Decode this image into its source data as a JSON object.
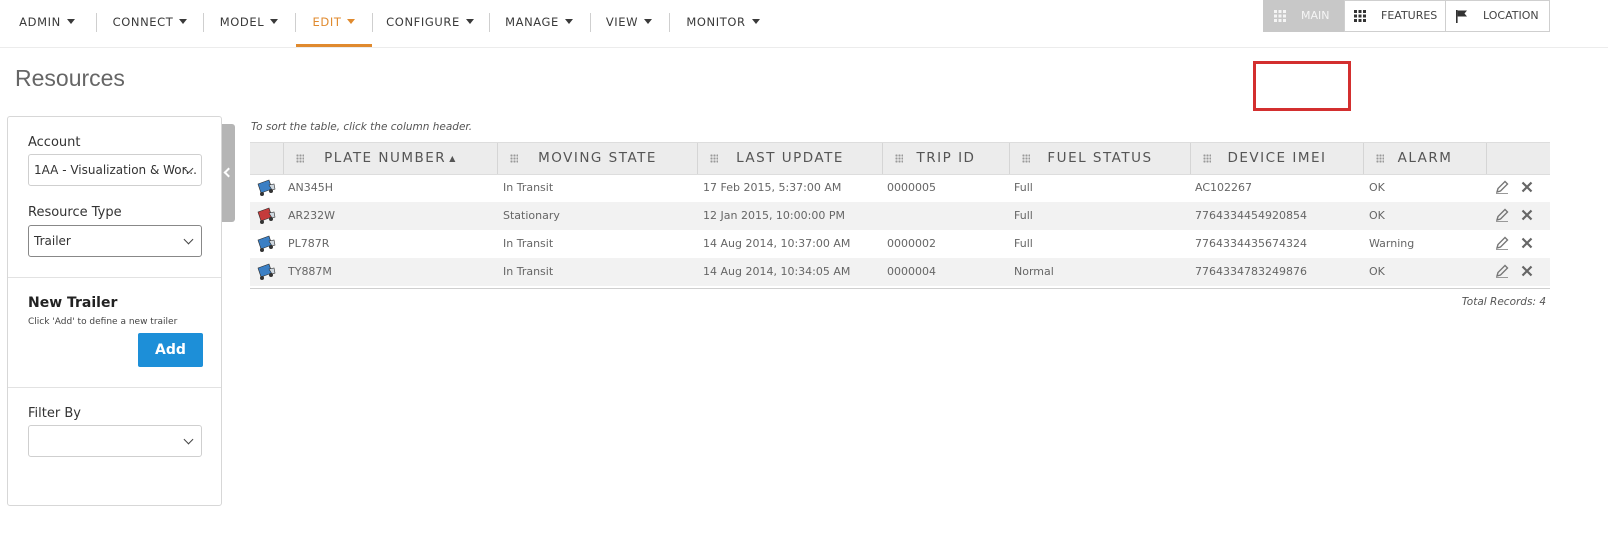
{
  "nav": {
    "items": [
      {
        "label": "ADMIN"
      },
      {
        "label": "CONNECT"
      },
      {
        "label": "MODEL"
      },
      {
        "label": "EDIT"
      },
      {
        "label": "CONFIGURE"
      },
      {
        "label": "MANAGE"
      },
      {
        "label": "VIEW"
      },
      {
        "label": "MONITOR"
      }
    ],
    "active": "EDIT"
  },
  "page": {
    "title": "Resources"
  },
  "views": {
    "main": "MAIN",
    "features": "FEATURES",
    "location": "LOCATION"
  },
  "sidebar": {
    "account_label": "Account",
    "account_value": "1AA - Visualization & Wor...",
    "resource_type_label": "Resource Type",
    "resource_type_value": "Trailer",
    "new_heading": "New Trailer",
    "new_hint": "Click 'Add' to define a new trailer",
    "add_label": "Add",
    "filter_label": "Filter By",
    "filter_value": ""
  },
  "table": {
    "sort_hint": "To sort the table, click the column header.",
    "columns": [
      "PLATE NUMBER",
      "MOVING STATE",
      "LAST UPDATE",
      "TRIP ID",
      "FUEL STATUS",
      "DEVICE IMEI",
      "ALARM"
    ],
    "sort_arrow": "▲",
    "rows": [
      {
        "plate": "AN345H",
        "state": "In Transit",
        "updated": "17 Feb 2015, 5:37:00 AM",
        "trip": "0000005",
        "fuel": "Full",
        "imei": "AC102267",
        "alarm": "OK",
        "icon_color": "#3b7fc4"
      },
      {
        "plate": "AR232W",
        "state": "Stationary",
        "updated": "12 Jan 2015, 10:00:00 PM",
        "trip": "",
        "fuel": "Full",
        "imei": "7764334454920854",
        "alarm": "OK",
        "icon_color": "#c43b3b"
      },
      {
        "plate": "PL787R",
        "state": "In Transit",
        "updated": "14 Aug 2014, 10:37:00 AM",
        "trip": "0000002",
        "fuel": "Full",
        "imei": "7764334435674324",
        "alarm": "Warning",
        "icon_color": "#3b7fc4"
      },
      {
        "plate": "TY887M",
        "state": "In Transit",
        "updated": "14 Aug 2014, 10:34:05 AM",
        "trip": "0000004",
        "fuel": "Normal",
        "imei": "7764334783249876",
        "alarm": "OK",
        "icon_color": "#3b7fc4"
      }
    ],
    "total": "Total Records: 4"
  }
}
